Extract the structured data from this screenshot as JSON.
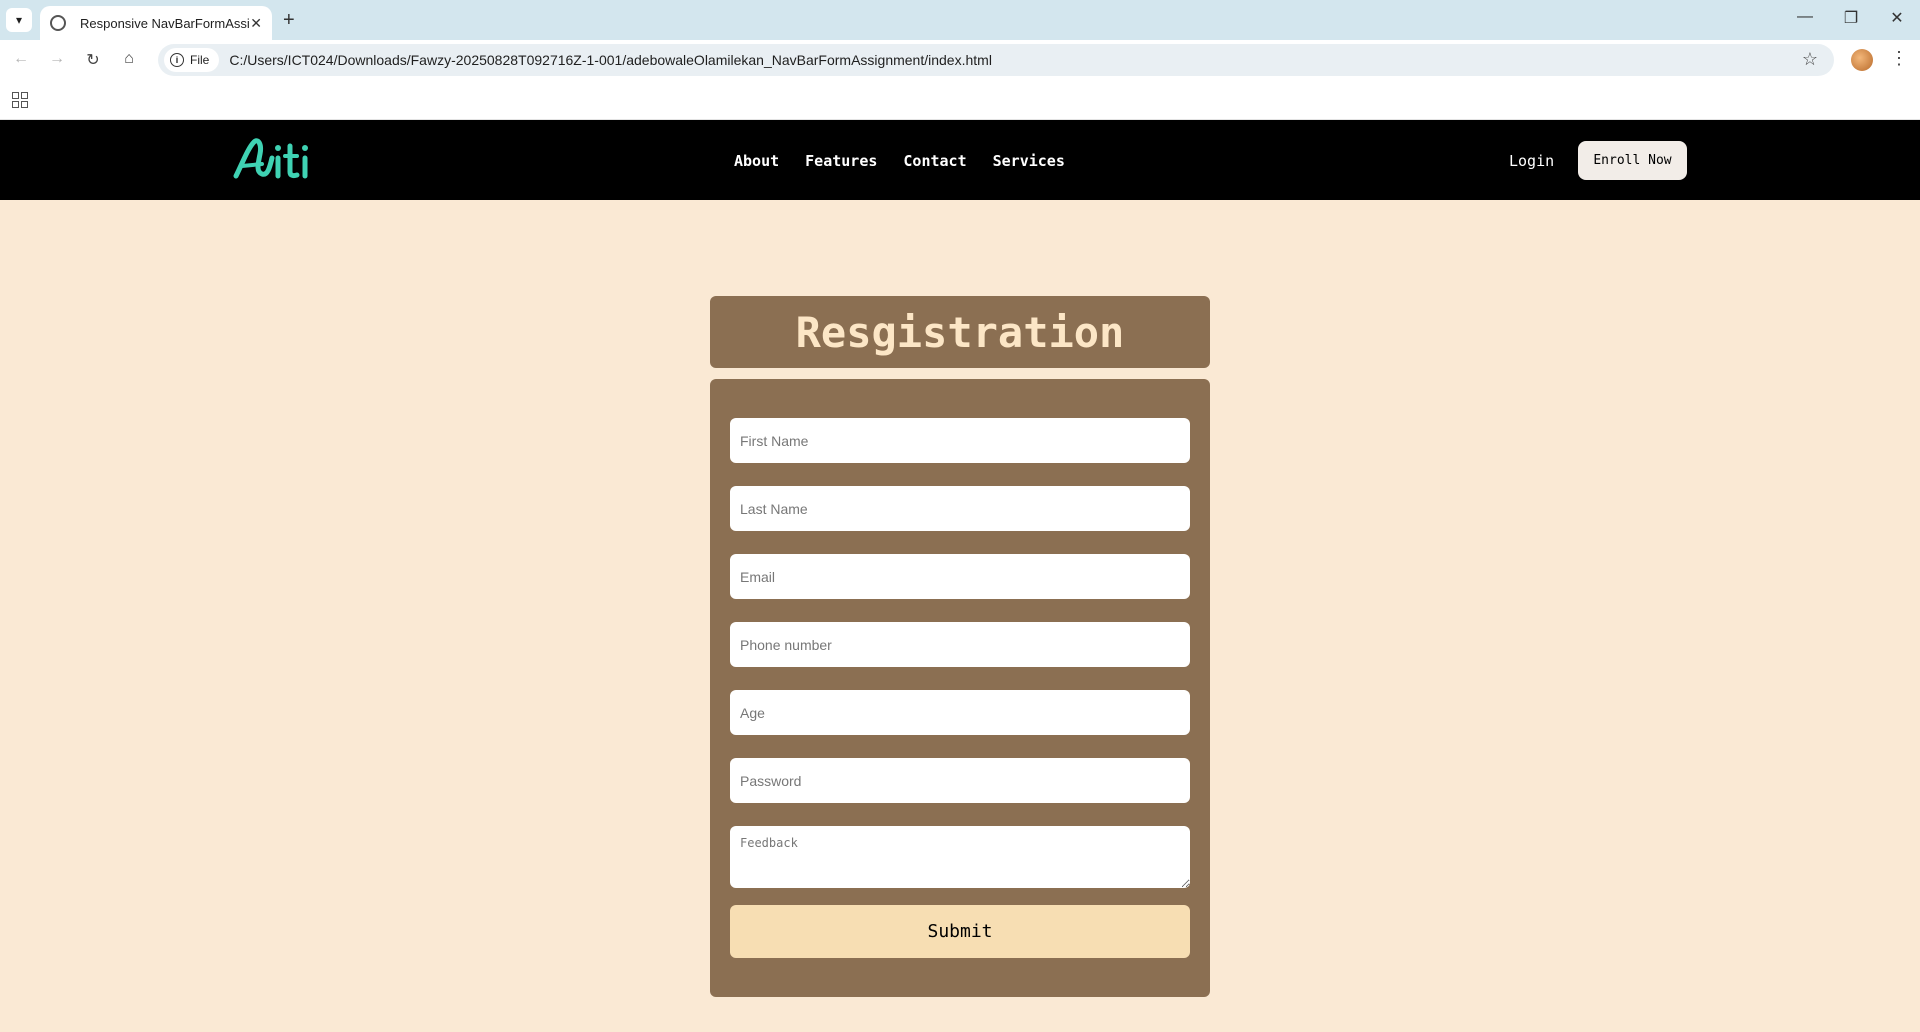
{
  "browser": {
    "tab_title": "Responsive NavBarFormAssignment",
    "tab_close": "✕",
    "new_tab": "+",
    "site_info_chip": "File",
    "url": "C:/Users/ICT024/Downloads/Fawzy-20250828T092716Z-1-001/adebowaleOlamilekan_NavBarFormAssignment/index.html",
    "window_controls": {
      "minimize": "—",
      "maximize": "❐",
      "close": "✕"
    }
  },
  "site": {
    "nav_links": [
      {
        "label": "About"
      },
      {
        "label": "Features"
      },
      {
        "label": "Contact"
      },
      {
        "label": "Services"
      }
    ],
    "login_label": "Login",
    "enroll_label": "Enroll Now",
    "logo_color": "#3fd2b3"
  },
  "form": {
    "title": "Resgistration",
    "fields": {
      "first_name": "First Name",
      "last_name": "Last Name",
      "email": "Email",
      "phone": "Phone number",
      "age": "Age",
      "password": "Password",
      "feedback": "Feedback"
    },
    "submit_label": "Submit"
  },
  "colors": {
    "page_bg": "#fae9d4",
    "card_bg": "#8b6f52",
    "title_text": "#fce6c6",
    "submit_bg": "#f7deb3"
  }
}
